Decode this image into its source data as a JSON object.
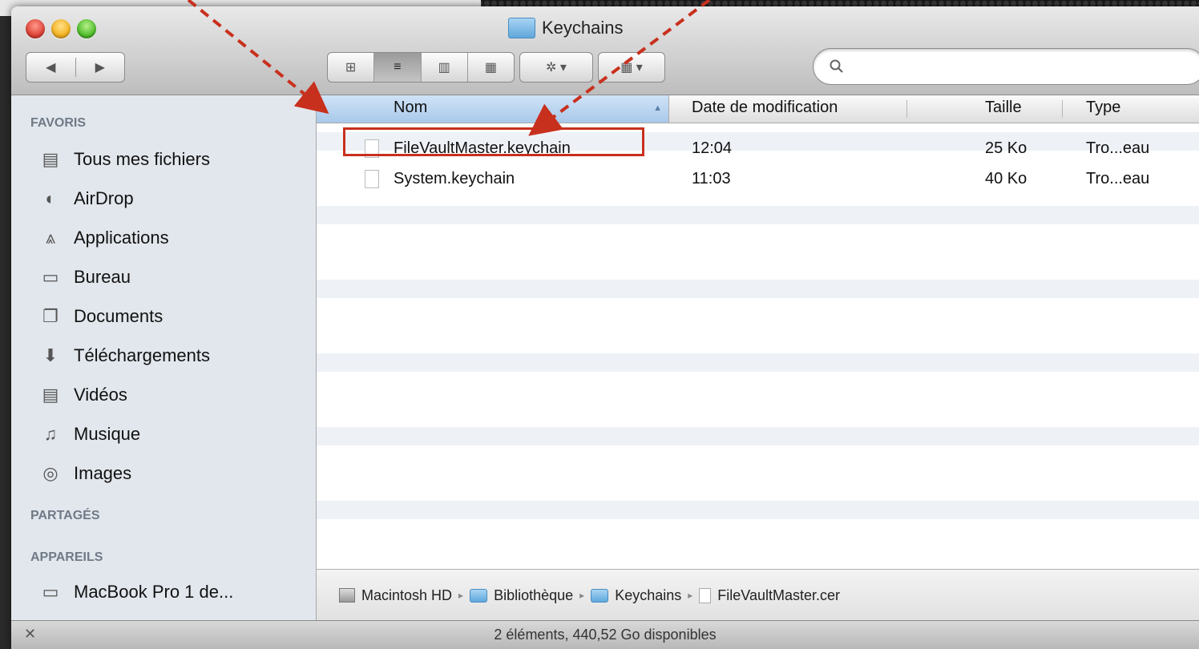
{
  "window": {
    "title": "Keychains"
  },
  "toolbar": {
    "back_glyph": "◀",
    "forward_glyph": "▶",
    "view_icons": [
      "⊞",
      "≡",
      "▥",
      "▦"
    ],
    "action_glyph": "✲ ▾",
    "arrange_glyph": "▦ ▾",
    "search_placeholder": ""
  },
  "sidebar": {
    "favoris_label": "FAVORIS",
    "favoris": [
      {
        "label": "Tous mes fichiers",
        "icon": "all-files-icon",
        "glyph": "▤"
      },
      {
        "label": "AirDrop",
        "icon": "airdrop-icon",
        "glyph": "◐"
      },
      {
        "label": "Applications",
        "icon": "applications-icon",
        "glyph": "⩓"
      },
      {
        "label": "Bureau",
        "icon": "desktop-icon",
        "glyph": "▭"
      },
      {
        "label": "Documents",
        "icon": "documents-icon",
        "glyph": "❐"
      },
      {
        "label": "Téléchargements",
        "icon": "downloads-icon",
        "glyph": "⬇"
      },
      {
        "label": "Vidéos",
        "icon": "movies-icon",
        "glyph": "▤"
      },
      {
        "label": "Musique",
        "icon": "music-icon",
        "glyph": "♫"
      },
      {
        "label": "Images",
        "icon": "pictures-icon",
        "glyph": "◎"
      }
    ],
    "partages_label": "PARTAGÉS",
    "appareils_label": "APPAREILS",
    "appareils": [
      {
        "label": "MacBook Pro 1 de...",
        "icon": "laptop-icon",
        "glyph": "▭"
      }
    ]
  },
  "list": {
    "columns": {
      "name": "Nom",
      "date": "Date de modification",
      "size": "Taille",
      "type": "Type"
    },
    "rows": [
      {
        "name": "FileVaultMaster.keychain",
        "date": "12:04",
        "size": "25 Ko",
        "type": "Tro...eau"
      },
      {
        "name": "System.keychain",
        "date": "11:03",
        "size": "40 Ko",
        "type": "Tro...eau"
      }
    ]
  },
  "pathbar": {
    "items": [
      "Macintosh HD",
      "Bibliothèque",
      "Keychains",
      "FileVaultMaster.cer"
    ],
    "separator": "▸"
  },
  "status": {
    "text": "2 éléments, 440,52 Go disponibles"
  },
  "colors": {
    "annotation": "#c8301e",
    "sidebar_bg": "#e2e7ed",
    "selected_header": "#a9c9ea"
  }
}
